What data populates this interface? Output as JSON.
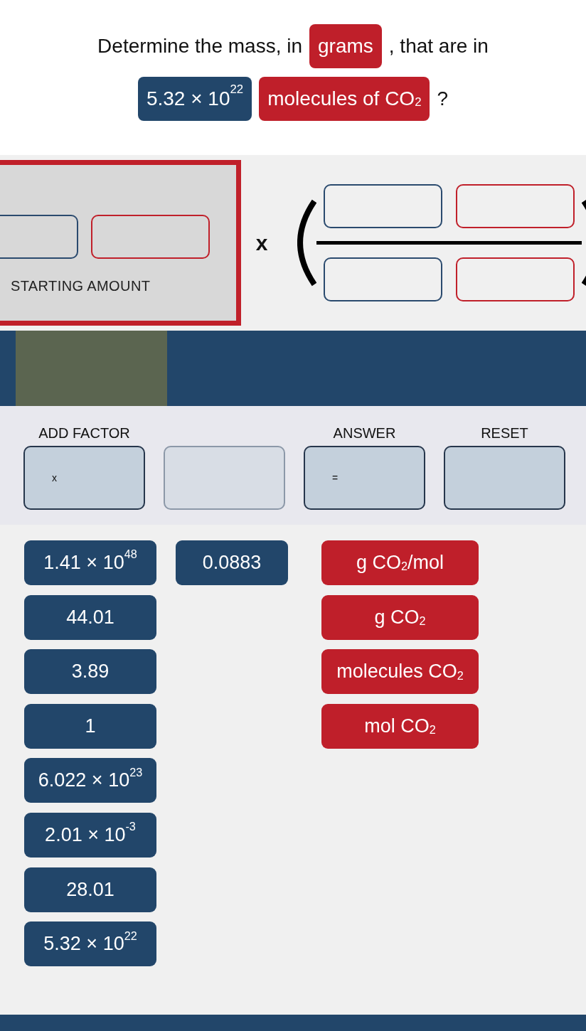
{
  "question": {
    "lines": [
      [
        {
          "kind": "text",
          "text": "Determine the mass, in"
        },
        {
          "kind": "unit",
          "text": "grams"
        },
        {
          "kind": "text",
          "text": ", that are in"
        }
      ],
      [
        {
          "kind": "number",
          "text": "5.32 × 10$^{22}$"
        },
        {
          "kind": "unit",
          "text": "molecules of CO$_{2}$"
        },
        {
          "kind": "text",
          "text": "?"
        }
      ]
    ]
  },
  "starting_amount": {
    "slots": [
      {
        "kind": "number"
      },
      {
        "kind": "unit"
      }
    ],
    "label": "STARTING AMOUNT"
  },
  "factor": {
    "operator": "x",
    "numerator": [
      {
        "kind": "number"
      },
      {
        "kind": "unit"
      }
    ],
    "denominator": [
      {
        "kind": "number"
      },
      {
        "kind": "unit"
      }
    ]
  },
  "controls": [
    {
      "label": "ADD FACTOR",
      "symbol": "x",
      "disabled": false
    },
    {
      "disabled": true
    },
    {
      "label": "ANSWER",
      "symbol": "=",
      "disabled": false
    },
    {
      "label": "RESET",
      "disabled": false
    }
  ],
  "tile_columns": [
    {
      "kind": "number",
      "tiles": [
        "1.41 × 10$^{48}$",
        "44.01",
        "3.89",
        "1",
        "6.022 × 10$^{23}$",
        "2.01 × 10$^{-3}$",
        "28.01",
        "5.32 × 10$^{22}$"
      ]
    },
    {
      "kind": "number",
      "tiles": [
        "0.0883"
      ]
    },
    {
      "kind": "unit",
      "tiles": [
        "g CO$_{2}$/mol",
        "g CO$_{2}$",
        "molecules CO$_{2}$",
        "mol CO$_{2}$"
      ]
    }
  ]
}
